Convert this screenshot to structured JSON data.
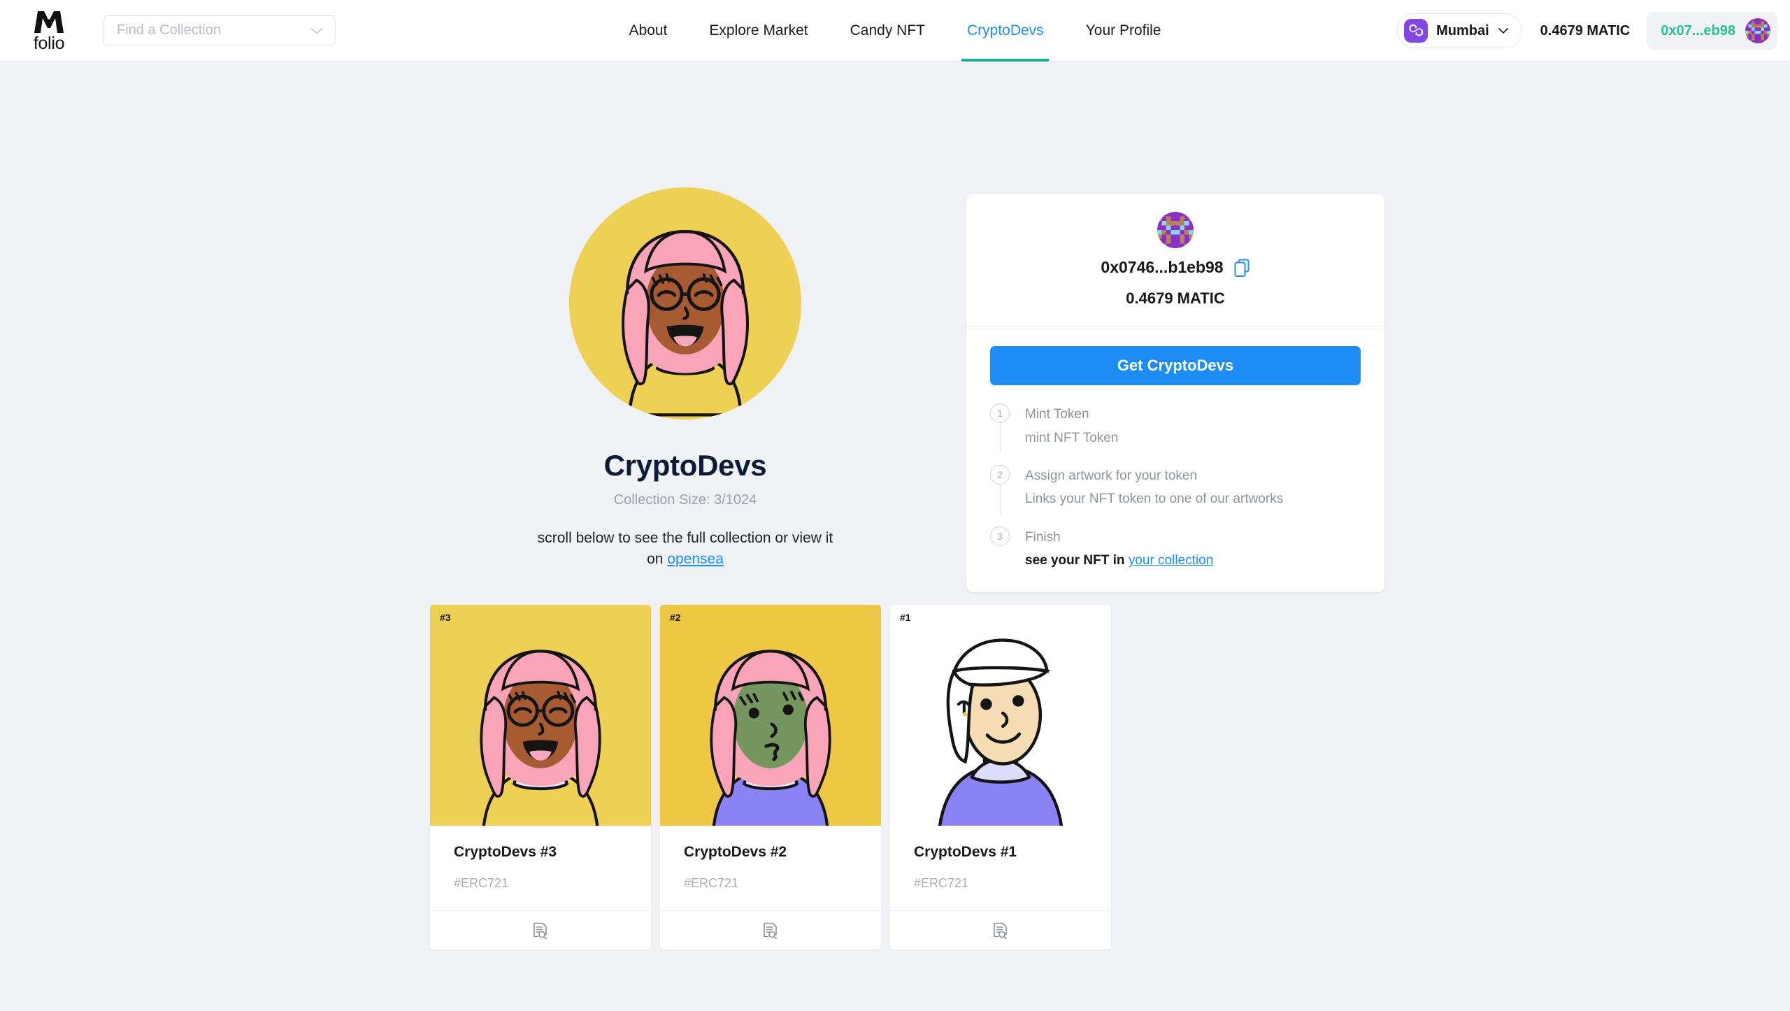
{
  "brand": {
    "word": "folio",
    "mark_icon": "m-folio-logo"
  },
  "search": {
    "placeholder": "Find a Collection",
    "chevron_icon": "chevron-down-icon"
  },
  "nav": {
    "items": [
      {
        "label": "About",
        "active": false
      },
      {
        "label": "Explore Market",
        "active": false
      },
      {
        "label": "Candy NFT",
        "active": false
      },
      {
        "label": "CryptoDevs",
        "active": true
      },
      {
        "label": "Your Profile",
        "active": false
      }
    ],
    "active_color": "#1d8df5",
    "underline_color": "#1aae94"
  },
  "header_right": {
    "network": {
      "name": "Mumbai",
      "icon": "polygon-logo-icon",
      "chevron_icon": "chevron-down-icon",
      "color": "#8247e5"
    },
    "balance": "0.4679 MATIC",
    "account": {
      "address_short": "0x07...eb98",
      "color": "#24c39a",
      "avatar_icon": "identicon-avatar"
    }
  },
  "hero": {
    "avatar_icon": "cryptodev-avatar-pink-hair",
    "title": "CryptoDevs",
    "collection_size": "Collection Size: 3/1024",
    "note_prefix": "scroll below to see the full collection or view it on ",
    "note_link": "opensea"
  },
  "panel": {
    "avatar_icon": "identicon-avatar",
    "address": "0x0746...b1eb98",
    "copy_icon": "copy-icon",
    "balance": "0.4679 MATIC",
    "cta_label": "Get CryptoDevs",
    "cta_color": "#1d8df5",
    "steps": [
      {
        "num": "1",
        "title": "Mint Token",
        "desc": "mint NFT Token"
      },
      {
        "num": "2",
        "title": "Assign artwork for your token",
        "desc": "Links your NFT token to one of our artworks"
      },
      {
        "num": "3",
        "title": "Finish",
        "desc_prefix": "see your NFT in ",
        "desc_link": "your collection"
      }
    ]
  },
  "cards": [
    {
      "badge": "#3",
      "title": "CryptoDevs #3",
      "standard": "#ERC721",
      "art_icon": "cryptodev-avatar-pink-hair-brown-skin",
      "bg": "#eed054",
      "footer_icon": "file-search-icon"
    },
    {
      "badge": "#2",
      "title": "CryptoDevs #2",
      "standard": "#ERC721",
      "art_icon": "cryptodev-avatar-pink-hair-green-skin",
      "bg": "#eec843",
      "footer_icon": "file-search-icon"
    },
    {
      "badge": "#1",
      "title": "CryptoDevs #1",
      "standard": "#ERC721",
      "art_icon": "cryptodev-avatar-white-hair",
      "bg": "#ffffff",
      "footer_icon": "file-search-icon"
    }
  ]
}
